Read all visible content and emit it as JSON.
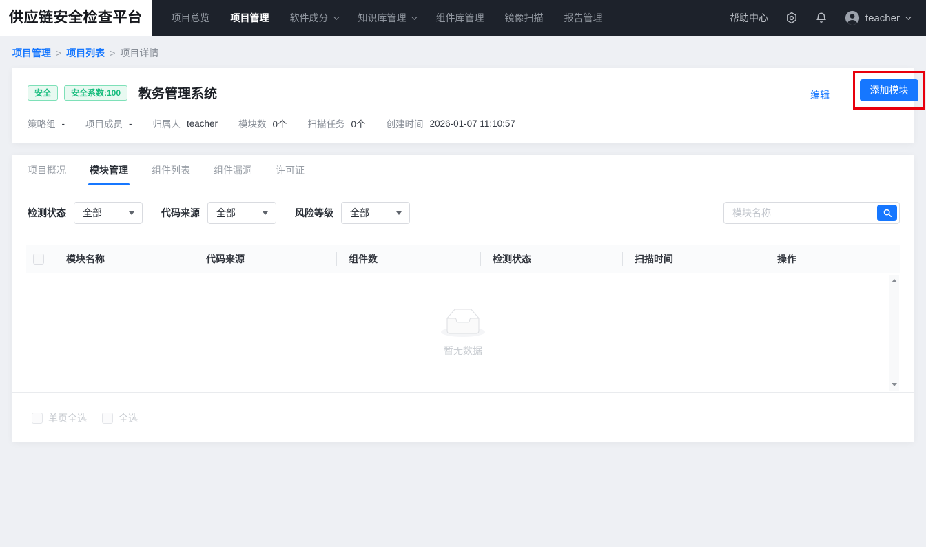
{
  "nav": {
    "logo": "供应链安全检查平台",
    "items": [
      {
        "label": "项目总览"
      },
      {
        "label": "项目管理"
      },
      {
        "label": "软件成分"
      },
      {
        "label": "知识库管理"
      },
      {
        "label": "组件库管理"
      },
      {
        "label": "镜像扫描"
      },
      {
        "label": "报告管理"
      }
    ],
    "help_label": "帮助中心",
    "username": "teacher"
  },
  "breadcrumb": {
    "separator": ">",
    "items": [
      {
        "label": "项目管理"
      },
      {
        "label": "项目列表"
      },
      {
        "label": "项目详情"
      }
    ]
  },
  "project": {
    "badges": [
      {
        "label": "安全"
      },
      {
        "label": "安全系数:100"
      }
    ],
    "title": "教务管理系统",
    "edit_label": "编辑",
    "add_module_label": "添加模块",
    "info": [
      {
        "label": "策略组",
        "value": "-"
      },
      {
        "label": "项目成员",
        "value": "-"
      },
      {
        "label": "归属人",
        "value": "teacher"
      },
      {
        "label": "模块数",
        "value": "0个"
      },
      {
        "label": "扫描任务",
        "value": "0个"
      },
      {
        "label": "创建时间",
        "value": "2026-01-07 11:10:57"
      }
    ]
  },
  "tabs": [
    {
      "label": "项目概况"
    },
    {
      "label": "模块管理"
    },
    {
      "label": "组件列表"
    },
    {
      "label": "组件漏洞"
    },
    {
      "label": "许可证"
    }
  ],
  "active_tab": "模块管理",
  "filters": [
    {
      "label": "检测状态",
      "value": "全部"
    },
    {
      "label": "代码来源",
      "value": "全部"
    },
    {
      "label": "风险等级",
      "value": "全部"
    }
  ],
  "search": {
    "placeholder": "模块名称"
  },
  "table": {
    "columns": [
      "模块名称",
      "代码来源",
      "组件数",
      "检测状态",
      "扫描时间",
      "操作"
    ],
    "rows": [],
    "empty_text": "暂无数据"
  },
  "footer": {
    "select_page_label": "单页全选",
    "select_all_label": "全选"
  },
  "colors": {
    "accent": "#1677ff",
    "success_text": "#18bd7e",
    "success_bg": "#e8f9f1",
    "navbar_bg": "#1d222b",
    "annotation_red": "#e8000d"
  }
}
